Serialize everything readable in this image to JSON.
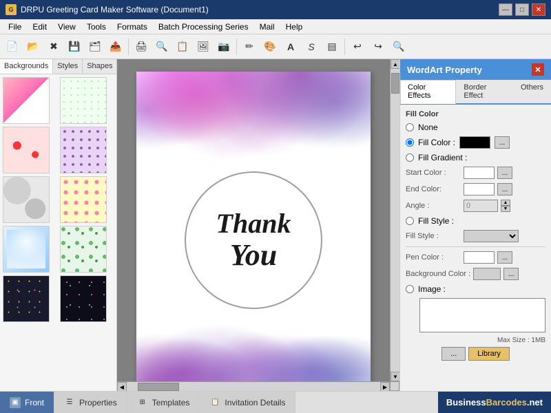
{
  "titlebar": {
    "icon": "G",
    "title": "DRPU Greeting Card Maker Software (Document1)",
    "controls": [
      "—",
      "□",
      "✕"
    ]
  },
  "menubar": {
    "items": [
      "File",
      "Edit",
      "View",
      "Tools",
      "Formats",
      "Batch Processing Series",
      "Mail",
      "Help"
    ]
  },
  "leftpanel": {
    "tabs": [
      "Backgrounds",
      "Styles",
      "Shapes"
    ],
    "active_tab": "Backgrounds"
  },
  "card": {
    "text_thank": "Thank",
    "text_you": "You"
  },
  "wordart": {
    "title": "WordArt Property",
    "close_label": "✕",
    "tabs": [
      "Color Effects",
      "Border Effect",
      "Others"
    ],
    "active_tab": "Color Effects",
    "fill_color_section": "Fill Color",
    "radio_none": "None",
    "radio_fill_color": "Fill Color :",
    "radio_fill_gradient": "Fill Gradient :",
    "start_color_label": "Start Color :",
    "end_color_label": "End Color:",
    "angle_label": "Angle :",
    "angle_value": "0",
    "radio_fill_style": "Fill Style :",
    "fill_style_label": "Fill Style :",
    "pen_color_label": "Pen Color :",
    "bg_color_label": "Background Color :",
    "radio_image": "Image :",
    "maxsize": "Max Size : 1MB",
    "btn_dots": "...",
    "btn_library": "Library"
  },
  "bottombar": {
    "tabs": [
      {
        "label": "Front",
        "icon": "▣",
        "active": true
      },
      {
        "label": "Properties",
        "icon": "☰",
        "active": false
      },
      {
        "label": "Templates",
        "icon": "⊞",
        "active": false
      },
      {
        "label": "Invitation Details",
        "icon": "📋",
        "active": false
      }
    ],
    "badge_text": "BusinessBarcodes.net"
  }
}
